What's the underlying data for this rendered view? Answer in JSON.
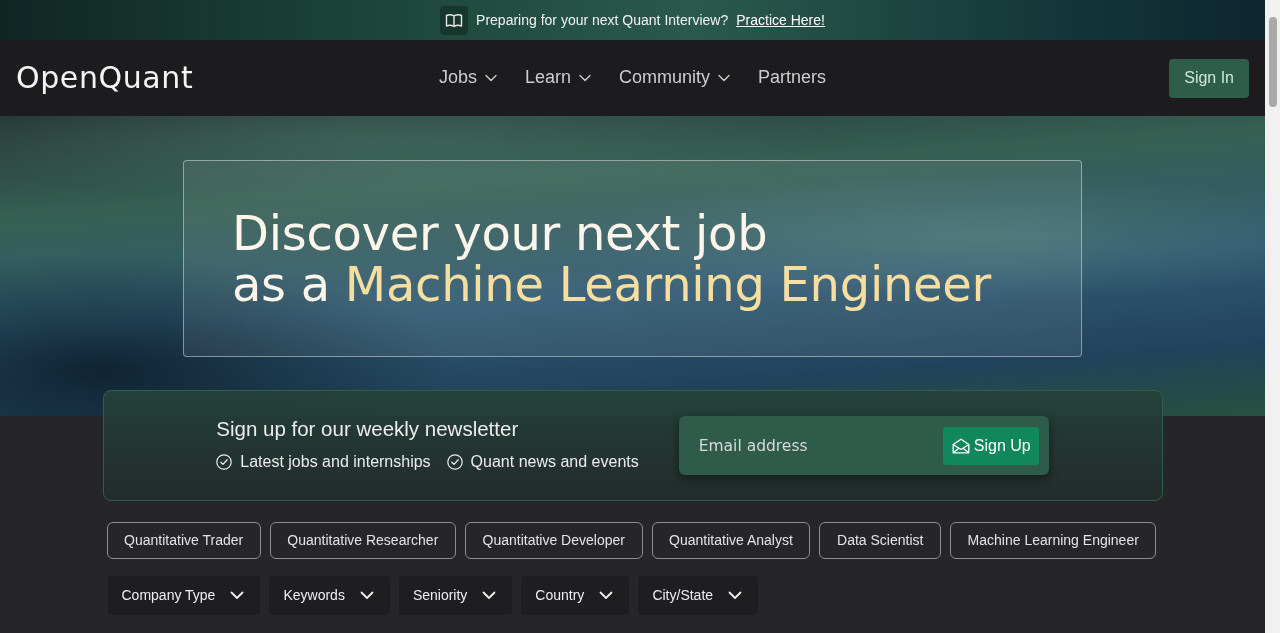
{
  "announcement": {
    "text": "Preparing for your next Quant Interview?",
    "link": "Practice Here!"
  },
  "navbar": {
    "brand": "OpenQuant",
    "menu": [
      {
        "label": "Jobs",
        "dropdown": true
      },
      {
        "label": "Learn",
        "dropdown": true
      },
      {
        "label": "Community",
        "dropdown": true
      },
      {
        "label": "Partners",
        "dropdown": false
      }
    ],
    "sign_in": "Sign In"
  },
  "hero": {
    "heading": {
      "line_1": "Discover your next job",
      "line_2_prefix": "as a",
      "highlight": "Machine Learning Engineer"
    }
  },
  "newsletter": {
    "title": "Sign up for our weekly newsletter",
    "benefits": [
      "Latest jobs and internships",
      "Quant news and events"
    ],
    "email": {
      "placeholder": "Email address"
    },
    "button": "Sign Up"
  },
  "roles": [
    "Quantitative Trader",
    "Quantitative Researcher",
    "Quantitative Developer",
    "Quantitative Analyst",
    "Data Scientist",
    "Machine Learning Engineer"
  ],
  "filters": [
    "Company Type",
    "Keywords",
    "Seniority",
    "Country",
    "City/State"
  ]
}
